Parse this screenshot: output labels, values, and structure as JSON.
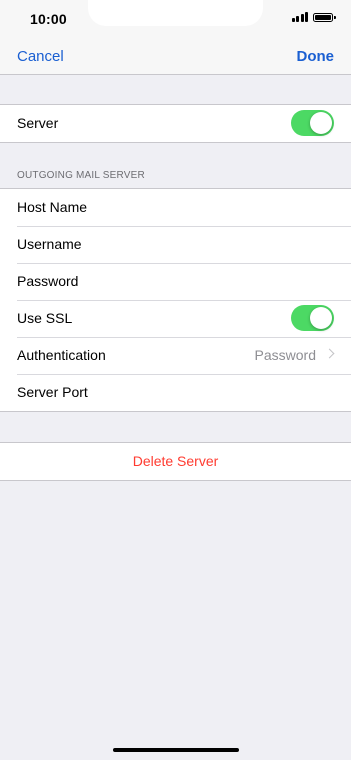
{
  "status_bar": {
    "time": "10:00"
  },
  "nav": {
    "cancel": "Cancel",
    "done": "Done"
  },
  "server_group": {
    "label": "Server",
    "toggle_on": true
  },
  "outgoing": {
    "header": "OUTGOING MAIL SERVER",
    "rows": [
      {
        "label": "Host Name"
      },
      {
        "label": "Username"
      },
      {
        "label": "Password"
      },
      {
        "label": "Use SSL",
        "toggle_on": true
      },
      {
        "label": "Authentication",
        "value": "Password"
      },
      {
        "label": "Server Port"
      }
    ]
  },
  "delete": {
    "label": "Delete Server"
  },
  "colors": {
    "accent": "#1a5fd2",
    "toggle_on": "#4cd964",
    "destructive": "#ff3b30",
    "background": "#efeff4"
  }
}
